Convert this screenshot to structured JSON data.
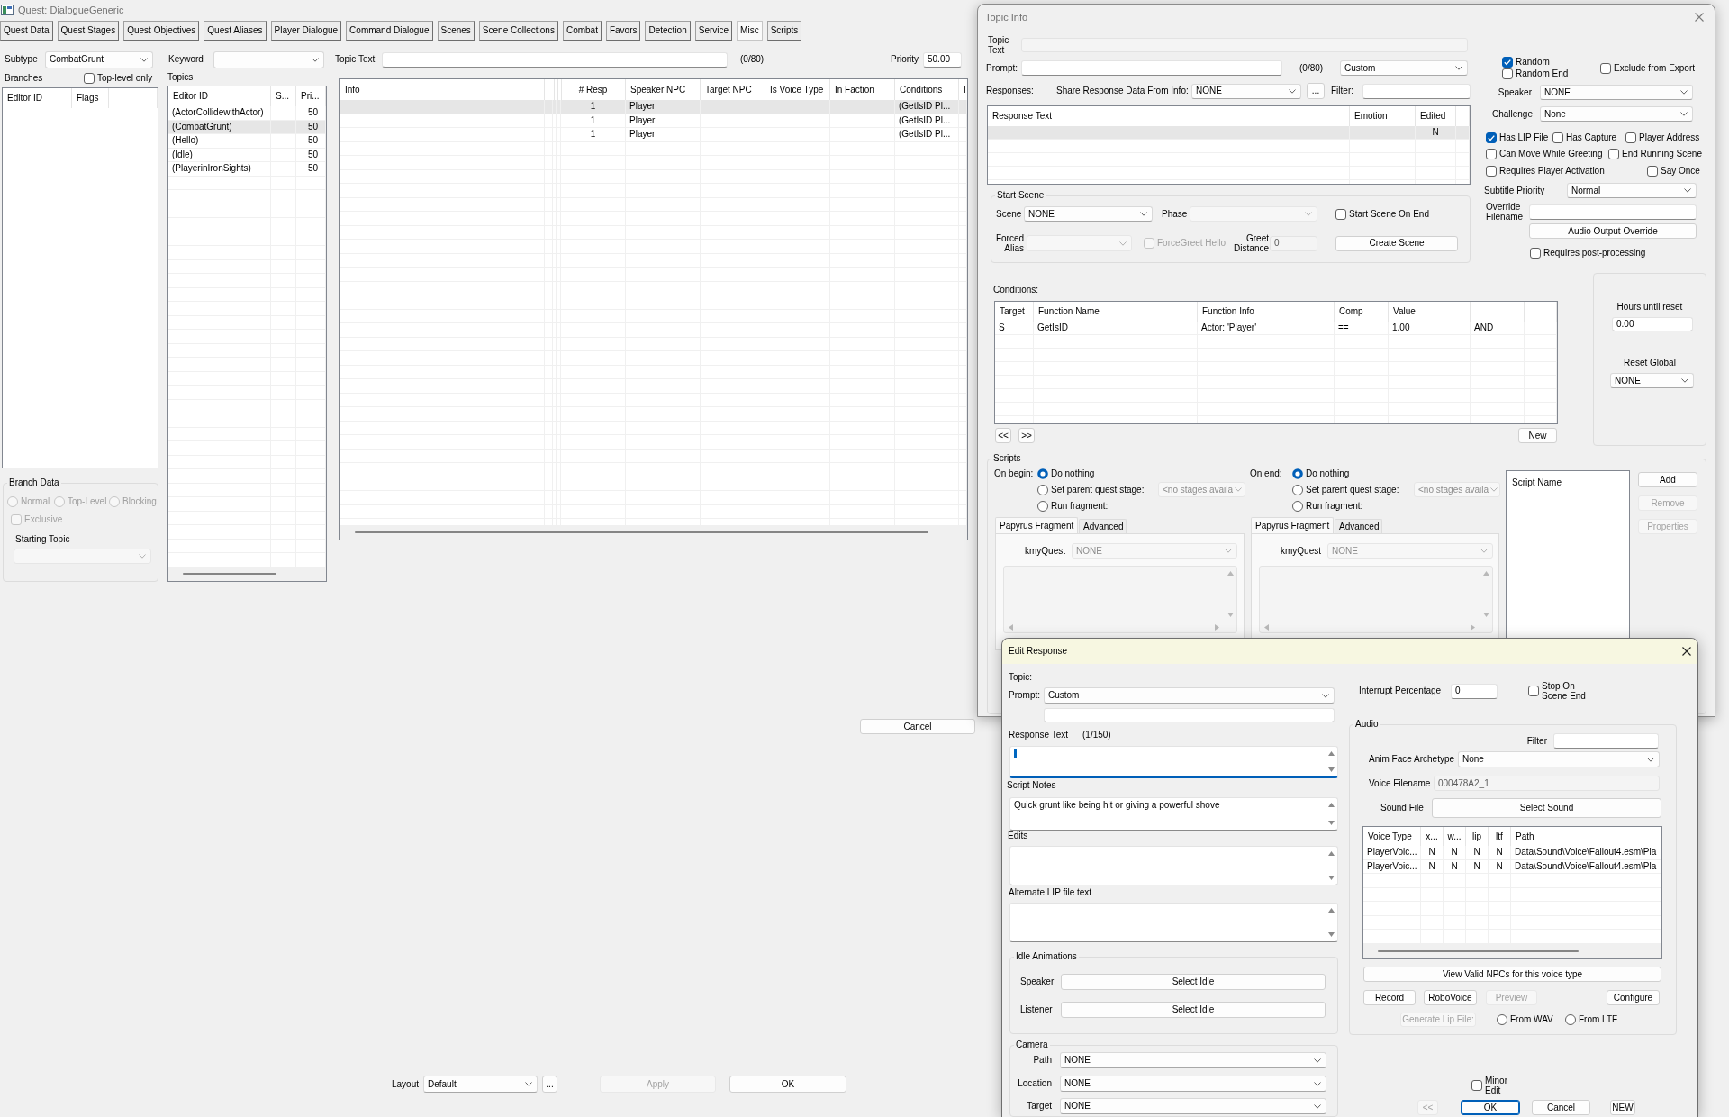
{
  "main_window": {
    "title": "Quest: DialogueGeneric",
    "tabs": [
      {
        "label": "Quest Data",
        "selected": false
      },
      {
        "label": "Quest Stages",
        "selected": false
      },
      {
        "label": "Quest Objectives",
        "selected": false
      },
      {
        "label": "Quest Aliases",
        "selected": false
      },
      {
        "label": "Player Dialogue",
        "selected": false
      },
      {
        "label": "Command Dialogue",
        "selected": false
      },
      {
        "label": "Scenes",
        "selected": false
      },
      {
        "label": "Scene Collections",
        "selected": false
      },
      {
        "label": "Combat",
        "selected": false
      },
      {
        "label": "Favors",
        "selected": false
      },
      {
        "label": "Detection",
        "selected": false
      },
      {
        "label": "Service",
        "selected": false
      },
      {
        "label": "Misc",
        "selected": true
      },
      {
        "label": "Scripts",
        "selected": false
      }
    ],
    "subtype": {
      "label": "Subtype",
      "value": "CombatGrunt"
    },
    "keyword": {
      "label": "Keyword"
    },
    "topic_text": {
      "label": "Topic Text",
      "counter": "(0/80)"
    },
    "priority": {
      "label": "Priority",
      "value": "50.00"
    },
    "branches": {
      "label": "Branches",
      "top_level_only": {
        "label": "Top-level only",
        "checked": false
      },
      "columns": [
        "Editor ID",
        "Flags"
      ]
    },
    "branch_data": {
      "title": "Branch Data",
      "disabled": true,
      "types": [
        {
          "label": "Normal",
          "selected": false
        },
        {
          "label": "Top-Level",
          "selected": false
        },
        {
          "label": "Blocking",
          "selected": false
        }
      ],
      "exclusive": {
        "label": "Exclusive",
        "checked": false
      },
      "starting_topic_label": "Starting Topic"
    },
    "topics": {
      "label": "Topics",
      "columns": [
        "Editor ID",
        "S...",
        "Pri..."
      ],
      "rows": [
        {
          "editor_id": "(ActorCollidewithActor)",
          "priority": "50",
          "selected": false
        },
        {
          "editor_id": "(CombatGrunt)",
          "priority": "50",
          "selected": true
        },
        {
          "editor_id": "(Hello)",
          "priority": "50",
          "selected": false
        },
        {
          "editor_id": "(Idle)",
          "priority": "50",
          "selected": false
        },
        {
          "editor_id": "(PlayerinIronSights)",
          "priority": "50",
          "selected": false
        }
      ]
    },
    "info_table": {
      "columns": [
        "Info",
        "# Resp",
        "Speaker NPC",
        "Target NPC",
        "Is Voice Type",
        "In Faction",
        "Conditions",
        "I"
      ],
      "rows": [
        {
          "responses": "1",
          "speaker_npc": "Player",
          "conditions": "(GetIsID Pl...",
          "selected": true
        },
        {
          "responses": "1",
          "speaker_npc": "Player",
          "conditions": "(GetIsID Pl...",
          "selected": false
        },
        {
          "responses": "1",
          "speaker_npc": "Player",
          "conditions": "(GetIsID Pl...",
          "selected": false
        }
      ]
    },
    "cancel_button": "Cancel",
    "layout": {
      "label": "Layout",
      "value": "Default",
      "more_button": "..."
    },
    "buttons": [
      {
        "label": "Apply",
        "disabled": true
      },
      {
        "label": "OK",
        "disabled": false
      }
    ]
  },
  "topic_info": {
    "title": "Topic Info",
    "topic_text": {
      "label": "Topic Text",
      "disabled": true
    },
    "prompt": {
      "label": "Prompt:",
      "counter": "(0/80)",
      "type": "Custom"
    },
    "responses": {
      "label": "Responses:",
      "share_label": "Share Response Data From Info:",
      "share_value": "NONE",
      "more_button": "...",
      "filter_label": "Filter:",
      "columns": [
        "Response Text",
        "Emotion",
        "Edited"
      ],
      "rows": [
        {
          "edited": "N",
          "selected": true
        }
      ]
    },
    "start_scene": {
      "title": "Start Scene",
      "scene": {
        "label": "Scene",
        "value": "NONE"
      },
      "phase": {
        "label": "Phase",
        "disabled": true
      },
      "start_on_end": {
        "label": "Start Scene On End",
        "checked": false
      },
      "forced_alias": {
        "label": "Forced Alias",
        "disabled": true
      },
      "force_greet": {
        "label": "ForceGreet Hello",
        "checked": false,
        "disabled": true
      },
      "greet_distance": {
        "label": "Greet Distance",
        "value": "0",
        "disabled": true
      },
      "create_button": "Create Scene"
    },
    "flags": [
      {
        "label": "Random",
        "checked": true
      },
      {
        "label": "Random End",
        "checked": false
      },
      {
        "label": "Exclude from Export",
        "checked": false
      }
    ],
    "speaker": {
      "label": "Speaker",
      "value": "NONE"
    },
    "challenge": {
      "label": "Challenge",
      "value": "None"
    },
    "options": [
      {
        "label": "Has LIP File",
        "checked": true
      },
      {
        "label": "Has Capture",
        "checked": false
      },
      {
        "label": "Player Address",
        "checked": false
      },
      {
        "label": "Can Move While Greeting",
        "checked": false
      },
      {
        "label": "End Running Scene",
        "checked": false
      },
      {
        "label": "Requires Player Activation",
        "checked": false
      },
      {
        "label": "Say Once",
        "checked": false
      }
    ],
    "subtitle_priority": {
      "label": "Subtitle Priority",
      "value": "Normal"
    },
    "override_filename": {
      "label": "Override Filename"
    },
    "audio_output_button": "Audio Output Override",
    "requires_post_processing": {
      "label": "Requires post-processing",
      "checked": false
    },
    "conditions": {
      "label": "Conditions:",
      "columns": [
        "Target",
        "Function Name",
        "Function Info",
        "Comp",
        "Value"
      ],
      "rows": [
        {
          "cells": [
            "S",
            "GetIsID",
            "Actor: 'Player'",
            "==",
            "1.00",
            "AND"
          ]
        }
      ],
      "buttons": [
        "<<",
        ">>",
        "New"
      ]
    },
    "reset": {
      "hours_label": "Hours until reset",
      "hours": "0.00",
      "global_label": "Reset Global",
      "global": "NONE"
    },
    "scripts": {
      "title": "Scripts",
      "on_begin": {
        "label": "On begin:",
        "choices": [
          {
            "label": "Do nothing",
            "selected": true
          },
          {
            "label": "Set parent quest stage:",
            "selected": false
          },
          {
            "label": "Run fragment:",
            "selected": false
          }
        ],
        "stage": {
          "value": "<no stages availa",
          "disabled": true
        },
        "tabs": [
          {
            "label": "Papyrus Fragment",
            "selected": true
          },
          {
            "label": "Advanced",
            "selected": false
          }
        ],
        "kmyquest": {
          "label": "kmyQuest",
          "value": "NONE",
          "disabled": true
        }
      },
      "on_end": {
        "label": "On end:",
        "choices": [
          {
            "label": "Do nothing",
            "selected": true
          },
          {
            "label": "Set parent quest stage:",
            "selected": false
          },
          {
            "label": "Run fragment:",
            "selected": false
          }
        ],
        "stage": {
          "value": "<no stages availa",
          "disabled": true
        },
        "tabs": [
          {
            "label": "Papyrus Fragment",
            "selected": true
          },
          {
            "label": "Advanced",
            "selected": false
          }
        ],
        "kmyquest": {
          "label": "kmyQuest",
          "value": "NONE",
          "disabled": true
        }
      },
      "script_list": {
        "column": "Script Name"
      },
      "buttons": [
        {
          "label": "Add",
          "disabled": false
        },
        {
          "label": "Remove",
          "disabled": true
        },
        {
          "label": "Properties",
          "disabled": true
        }
      ]
    }
  },
  "edit_response": {
    "title": "Edit Response",
    "topic_label": "Topic:",
    "prompt": {
      "label": "Prompt:",
      "value": "Custom"
    },
    "response_text": {
      "label": "Response Text",
      "counter": "(1/150)",
      "focused": true
    },
    "script_notes": {
      "label": "Script Notes",
      "value": "Quick grunt like being hit or giving a powerful shove"
    },
    "edits": {
      "label": "Edits"
    },
    "alternate_lip_text": {
      "label": "Alternate LIP file text"
    },
    "idle_animations": {
      "title": "Idle Animations",
      "rows": [
        {
          "label": "Speaker",
          "button": "Select Idle"
        },
        {
          "label": "Listener",
          "button": "Select Idle"
        }
      ]
    },
    "camera": {
      "title": "Camera",
      "rows": [
        {
          "label": "Path",
          "value": "NONE"
        },
        {
          "label": "Location",
          "value": "NONE"
        },
        {
          "label": "Target",
          "value": "NONE"
        }
      ]
    },
    "interrupt": {
      "label": "Interrupt Percentage",
      "value": "0"
    },
    "stop_on_scene_end": {
      "label": "Stop On Scene End",
      "checked": false
    },
    "audio": {
      "title": "Audio",
      "filter_label": "Filter",
      "anim_face": {
        "label": "Anim Face Archetype",
        "value": "None"
      },
      "voice_filename": {
        "label": "Voice Filename",
        "value": "000478A2_1",
        "disabled": true
      },
      "sound_file": {
        "label": "Sound File",
        "button": "Select Sound"
      },
      "columns": [
        "Voice Type",
        "x...",
        "w...",
        "lip",
        "ltf",
        "Path"
      ],
      "rows": [
        {
          "cells": [
            "PlayerVoic...",
            "N",
            "N",
            "N",
            "N",
            "Data\\Sound\\Voice\\Fallout4.esm\\Pla"
          ]
        },
        {
          "cells": [
            "PlayerVoic...",
            "N",
            "N",
            "N",
            "N",
            "Data\\Sound\\Voice\\Fallout4.esm\\Pla"
          ]
        }
      ],
      "view_npcs_button": "View Valid NPCs for this voice type",
      "buttons": [
        {
          "label": "Record",
          "disabled": false
        },
        {
          "label": "RoboVoice",
          "disabled": false
        },
        {
          "label": "Preview",
          "disabled": true
        },
        {
          "label": "Configure",
          "disabled": false
        }
      ],
      "generate_lip": {
        "label": "Generate Lip File:",
        "disabled": true
      },
      "lip_sources": [
        {
          "label": "From WAV",
          "selected": false
        },
        {
          "label": "From LTF",
          "selected": false
        }
      ]
    },
    "minor_edit": {
      "label": "Minor Edit",
      "checked": false
    },
    "footer_buttons": [
      {
        "label": "<<",
        "disabled": true,
        "default": false
      },
      {
        "label": "OK",
        "disabled": false,
        "default": true
      },
      {
        "label": "Cancel",
        "disabled": false,
        "default": false
      },
      {
        "label": "NEW",
        "disabled": false,
        "default": false
      }
    ]
  }
}
